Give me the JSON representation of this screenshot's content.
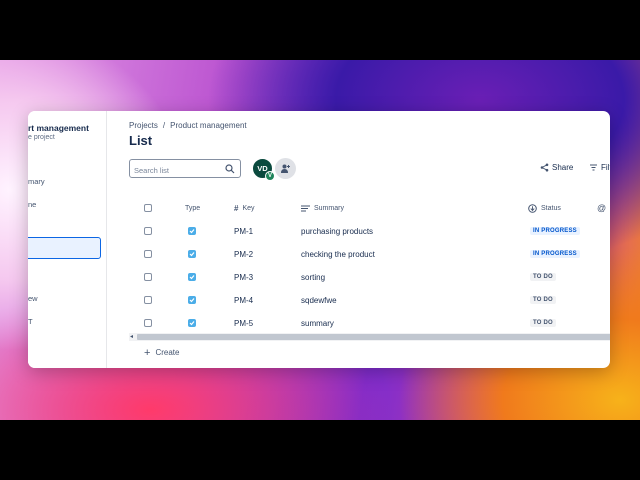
{
  "sidebar": {
    "project_title": "rt management",
    "project_subtitle": "e project",
    "items": [
      {
        "label": "mary"
      },
      {
        "label": "ne"
      },
      {
        "label": ""
      },
      {
        "label": "ew"
      },
      {
        "label": "T"
      }
    ]
  },
  "breadcrumb": {
    "root": "Projects",
    "separator": "/",
    "current": "Product management"
  },
  "page_title": "List",
  "search": {
    "placeholder": "Search list",
    "value": ""
  },
  "avatars": {
    "user_initials": "VD",
    "badge": "V"
  },
  "toolbar": {
    "share_label": "Share",
    "filter_label": "Filt"
  },
  "table": {
    "headers": {
      "type": "Type",
      "key": "Key",
      "summary": "Summary",
      "status": "Status"
    },
    "rows": [
      {
        "key": "PM-1",
        "summary": "purchasing products",
        "status": "IN PROGRESS"
      },
      {
        "key": "PM-2",
        "summary": "checking the product",
        "status": "IN PROGRESS"
      },
      {
        "key": "PM-3",
        "summary": "sorting",
        "status": "TO DO"
      },
      {
        "key": "PM-4",
        "summary": "sqdewfwe",
        "status": "TO DO"
      },
      {
        "key": "PM-5",
        "summary": "summary",
        "status": "TO DO"
      }
    ]
  },
  "create_label": "Create",
  "colors": {
    "accent": "#0c66e4",
    "in_progress_bg": "#e9f2ff",
    "in_progress_text": "#0055cc",
    "todo_bg": "#f1f2f4",
    "todo_text": "#44546f",
    "task_icon": "#4bade8"
  },
  "icons": [
    "search-icon",
    "share-icon",
    "filter-icon",
    "hash-icon",
    "summary-lines-icon",
    "status-icon",
    "mention-icon",
    "add-people-icon",
    "plus-icon",
    "task-checkbox-icon"
  ]
}
